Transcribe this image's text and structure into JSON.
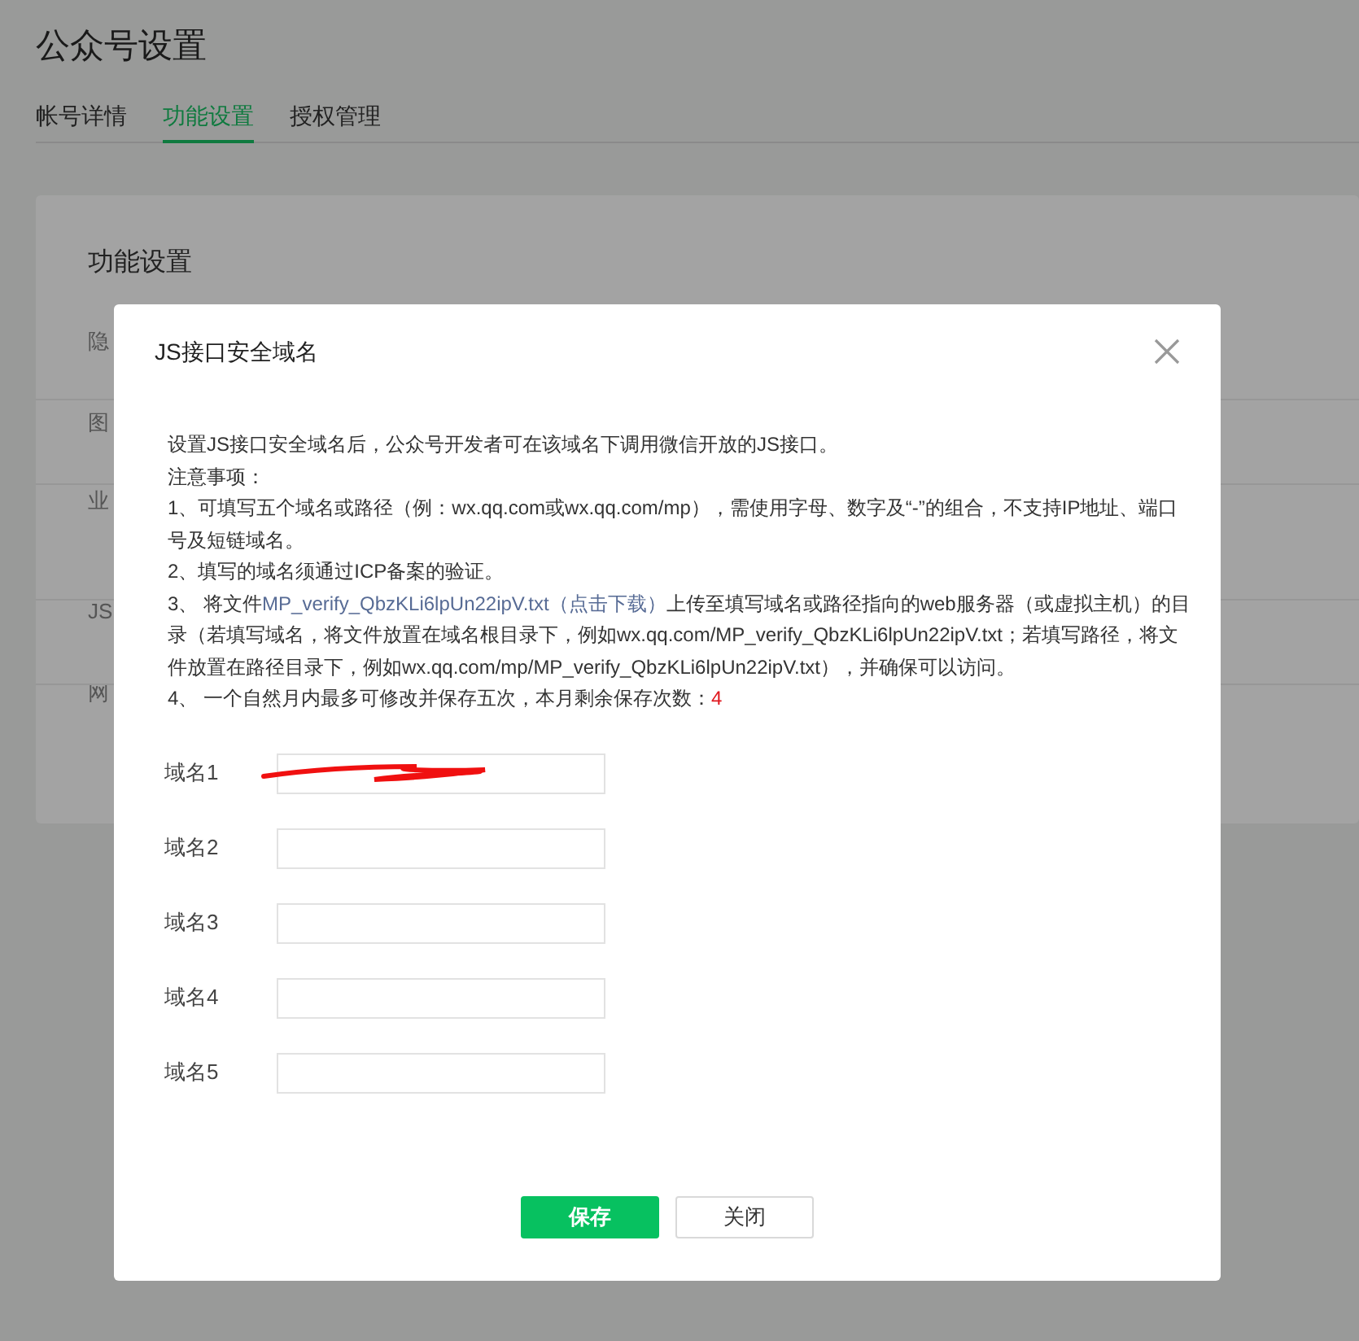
{
  "page": {
    "title": "公众号设置"
  },
  "tabs": [
    {
      "label": "帐号详情",
      "selected": false
    },
    {
      "label": "功能设置",
      "selected": true
    },
    {
      "label": "授权管理",
      "selected": false
    }
  ],
  "card": {
    "title": "功能设置",
    "row_labels": [
      "隐",
      "图",
      "业",
      "JS",
      "网"
    ]
  },
  "dialog": {
    "title": "JS接口安全域名",
    "intro": "设置JS接口安全域名后，公众号开发者可在该域名下调用微信开放的JS接口。",
    "notes_heading": "注意事项：",
    "notes": [
      {
        "kind": "text",
        "text": "1、可填写五个域名或路径（例：wx.qq.com或wx.qq.com/mp），需使用字母、数字及“-”的组合，不支持IP地址、端口号及短链域名。"
      },
      {
        "kind": "text",
        "text": "2、填写的域名须通过ICP备案的验证。"
      },
      {
        "kind": "link",
        "before": "3、 将文件",
        "link": "MP_verify_QbzKLi6lpUn22ipV.txt（点击下载）",
        "after": "上传至填写域名或路径指向的web服务器（或虚拟主机）的目录（若填写域名，将文件放置在域名根目录下，例如wx.qq.com/MP_verify_QbzKLi6lpUn22ipV.txt；若填写路径，将文件放置在路径目录下，例如wx.qq.com/mp/MP_verify_QbzKLi6lpUn22ipV.txt），并确保可以访问。"
      },
      {
        "kind": "count",
        "text": "4、 一个自然月内最多可修改并保存五次，本月剩余保存次数：",
        "count": "4"
      }
    ],
    "fields": [
      {
        "label": "域名1",
        "redacted": true
      },
      {
        "label": "域名2",
        "redacted": false
      },
      {
        "label": "域名3",
        "redacted": false
      },
      {
        "label": "域名4",
        "redacted": false
      },
      {
        "label": "域名5",
        "redacted": false
      }
    ],
    "buttons": [
      {
        "label": "保存",
        "kind": "primary"
      },
      {
        "label": "关闭",
        "kind": "default"
      }
    ]
  }
}
